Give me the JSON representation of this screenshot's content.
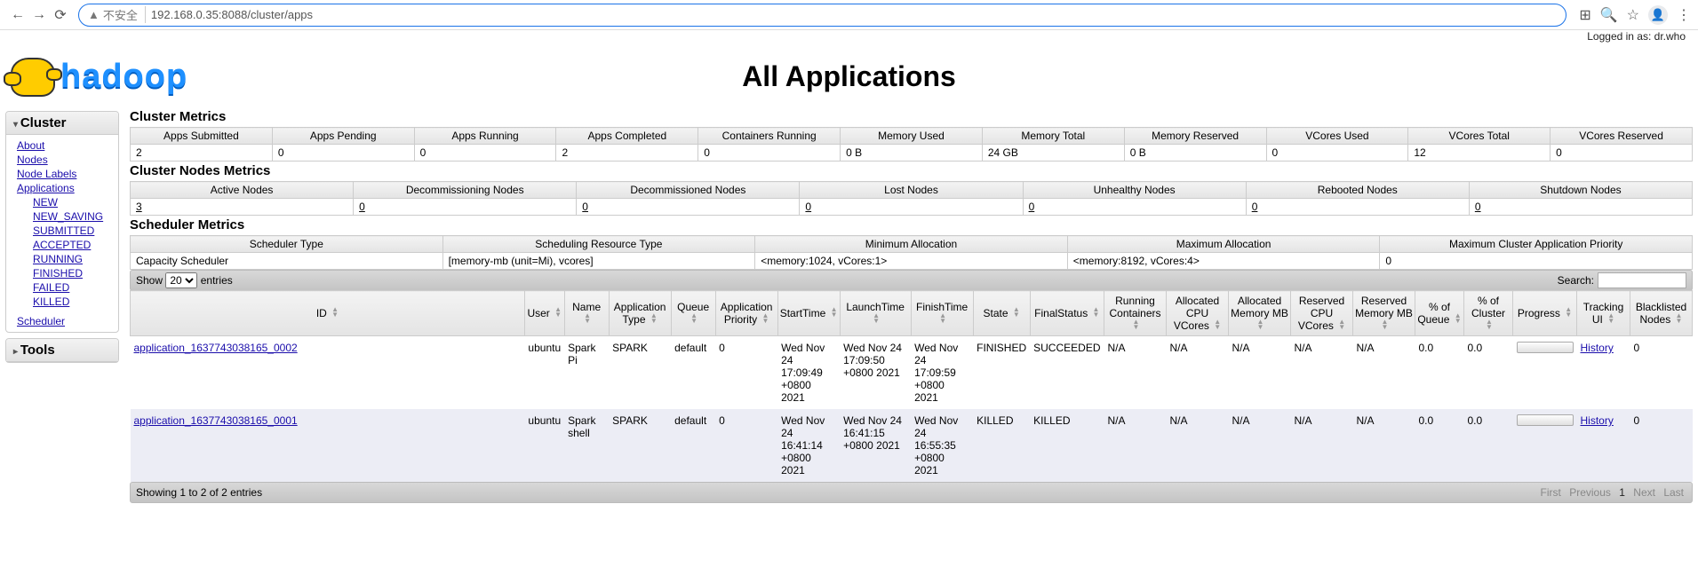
{
  "browser": {
    "insecure_icon": "▲",
    "insecure_label": "不安全",
    "url": "192.168.0.35:8088/cluster/apps"
  },
  "header": {
    "logo_text": "hadoop",
    "title": "All Applications",
    "login_text": "Logged in as: dr.who"
  },
  "sidebar": {
    "cluster_title": "Cluster",
    "links": {
      "about": "About",
      "nodes": "Nodes",
      "node_labels": "Node Labels",
      "applications": "Applications",
      "scheduler": "Scheduler"
    },
    "app_states": [
      "NEW",
      "NEW_SAVING",
      "SUBMITTED",
      "ACCEPTED",
      "RUNNING",
      "FINISHED",
      "FAILED",
      "KILLED"
    ],
    "tools_title": "Tools"
  },
  "cluster_metrics": {
    "title": "Cluster Metrics",
    "headers": [
      "Apps Submitted",
      "Apps Pending",
      "Apps Running",
      "Apps Completed",
      "Containers Running",
      "Memory Used",
      "Memory Total",
      "Memory Reserved",
      "VCores Used",
      "VCores Total",
      "VCores Reserved"
    ],
    "values": [
      "2",
      "0",
      "0",
      "2",
      "0",
      "0 B",
      "24 GB",
      "0 B",
      "0",
      "12",
      "0"
    ]
  },
  "node_metrics": {
    "title": "Cluster Nodes Metrics",
    "headers": [
      "Active Nodes",
      "Decommissioning Nodes",
      "Decommissioned Nodes",
      "Lost Nodes",
      "Unhealthy Nodes",
      "Rebooted Nodes",
      "Shutdown Nodes"
    ],
    "values": [
      "3",
      "0",
      "0",
      "0",
      "0",
      "0",
      "0"
    ]
  },
  "sched_metrics": {
    "title": "Scheduler Metrics",
    "headers": [
      "Scheduler Type",
      "Scheduling Resource Type",
      "Minimum Allocation",
      "Maximum Allocation",
      "Maximum Cluster Application Priority"
    ],
    "values": [
      "Capacity Scheduler",
      "[memory-mb (unit=Mi), vcores]",
      "<memory:1024, vCores:1>",
      "<memory:8192, vCores:4>",
      "0"
    ]
  },
  "datatable": {
    "show_label": "Show",
    "entries_label": "entries",
    "options": [
      "20"
    ],
    "search_label": "Search:",
    "headers": [
      "ID",
      "User",
      "Name",
      "Application Type",
      "Queue",
      "Application Priority",
      "StartTime",
      "LaunchTime",
      "FinishTime",
      "State",
      "FinalStatus",
      "Running Containers",
      "Allocated CPU VCores",
      "Allocated Memory MB",
      "Reserved CPU VCores",
      "Reserved Memory MB",
      "% of Queue",
      "% of Cluster",
      "Progress",
      "Tracking UI",
      "Blacklisted Nodes"
    ],
    "rows": [
      {
        "id": "application_1637743038165_0002",
        "user": "ubuntu",
        "name": "Spark Pi",
        "type": "SPARK",
        "queue": "default",
        "priority": "0",
        "start": "Wed Nov 24 17:09:49 +0800 2021",
        "launch": "Wed Nov 24 17:09:50 +0800 2021",
        "finish": "Wed Nov 24 17:09:59 +0800 2021",
        "state": "FINISHED",
        "final": "SUCCEEDED",
        "rc": "N/A",
        "ac": "N/A",
        "am": "N/A",
        "rcv": "N/A",
        "rm": "N/A",
        "pq": "0.0",
        "pc": "0.0",
        "track": "History",
        "bl": "0"
      },
      {
        "id": "application_1637743038165_0001",
        "user": "ubuntu",
        "name": "Spark shell",
        "type": "SPARK",
        "queue": "default",
        "priority": "0",
        "start": "Wed Nov 24 16:41:14 +0800 2021",
        "launch": "Wed Nov 24 16:41:15 +0800 2021",
        "finish": "Wed Nov 24 16:55:35 +0800 2021",
        "state": "KILLED",
        "final": "KILLED",
        "rc": "N/A",
        "ac": "N/A",
        "am": "N/A",
        "rcv": "N/A",
        "rm": "N/A",
        "pq": "0.0",
        "pc": "0.0",
        "track": "History",
        "bl": "0"
      }
    ],
    "info": "Showing 1 to 2 of 2 entries",
    "pager": {
      "first": "First",
      "prev": "Previous",
      "page": "1",
      "next": "Next",
      "last": "Last"
    }
  }
}
